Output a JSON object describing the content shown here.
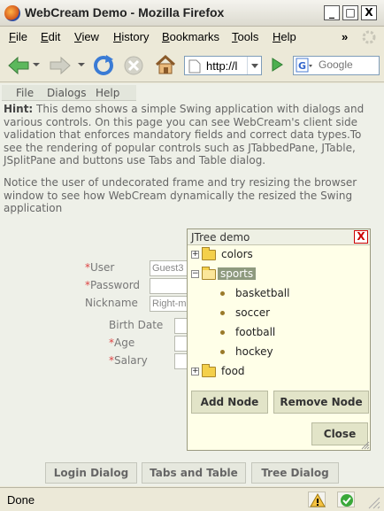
{
  "window": {
    "title": "WebCream Demo - Mozilla Firefox",
    "buttons": {
      "minimize": "_",
      "maximize": "□",
      "close": "X"
    }
  },
  "menubar": {
    "items": [
      "File",
      "Edit",
      "View",
      "History",
      "Bookmarks",
      "Tools",
      "Help"
    ],
    "overflow": "»"
  },
  "navbar": {
    "url": "http://l",
    "search_placeholder": "Google"
  },
  "appmenu": {
    "items": [
      "File",
      "Dialogs",
      "Help"
    ]
  },
  "hint": {
    "label": "Hint:",
    "text": " This demo shows a simple Swing application with dialogs and various controls. On this page you can see WebCream's client side validation that enforces mandatory fields and correct data types.To see the rendering of popular controls such as JTabbedPane, JTable, JSplitPane and buttons use Tabs and Table dialog."
  },
  "note": "Notice the user of undecorated frame and try resizing the browser window to see how WebCream dynamically the resized the Swing application",
  "form": {
    "user_label": "User",
    "user_value": "Guest3",
    "password_label": "Password",
    "nickname_label": "Nickname",
    "nickname_value": "Right-mo",
    "birth_date_label": "Birth Date",
    "age_label": "Age",
    "salary_label": "Salary",
    "required_mark": "*"
  },
  "bottom_buttons": {
    "login": "Login Dialog",
    "tabs": "Tabs and Table",
    "tree": "Tree Dialog"
  },
  "tree_dialog": {
    "title": "JTree demo",
    "close_x": "X",
    "nodes": {
      "colors": "colors",
      "sports": "sports",
      "basketball": "basketball",
      "soccer": "soccer",
      "football": "football",
      "hockey": "hockey",
      "food": "food"
    },
    "expanders": {
      "colors": "+",
      "sports": "−",
      "food": "+"
    },
    "add_node": "Add Node",
    "remove_node": "Remove Node",
    "close": "Close"
  },
  "status": {
    "text": "Done"
  },
  "colors": {
    "accent": "#8e9a7e",
    "required": "#dd4444",
    "folder": "#f4d04a"
  }
}
